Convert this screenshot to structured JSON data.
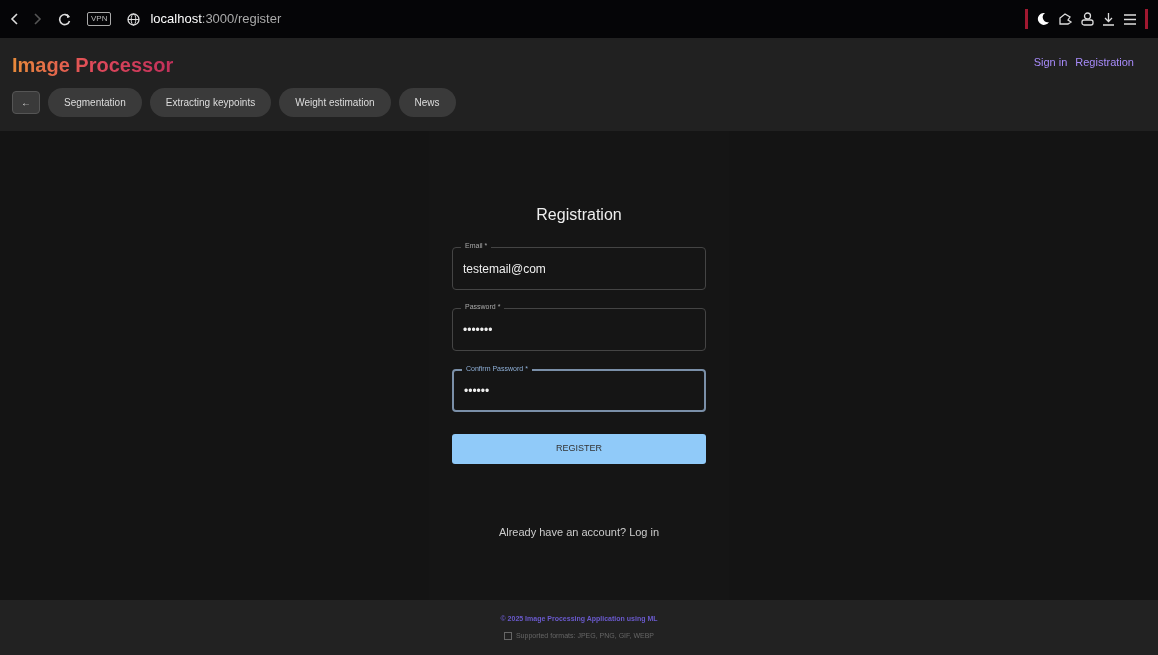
{
  "browser": {
    "vpn_badge": "VPN",
    "url_host": "localhost",
    "url_path": ":3000/register"
  },
  "app": {
    "title": "Image Processor",
    "auth_links": [
      {
        "label": "Sign in"
      },
      {
        "label": "Registration"
      }
    ],
    "back_button": "←",
    "nav": [
      {
        "label": "Segmentation"
      },
      {
        "label": "Extracting keypoints"
      },
      {
        "label": "Weight estimation"
      },
      {
        "label": "News"
      }
    ]
  },
  "form": {
    "title": "Registration",
    "fields": [
      {
        "label": "Email",
        "required": "*",
        "value": "testemail@com",
        "focused": false
      },
      {
        "label": "Password",
        "required": "*",
        "value": "•••••••",
        "focused": false
      },
      {
        "label": "Confirm Password",
        "required": "*",
        "value": "••••••",
        "focused": true
      }
    ],
    "submit": "REGISTER",
    "login_prompt": "Already have an account? Log in"
  },
  "footer": {
    "copyright": "© 2025 Image Processing Application using ML",
    "formats": "Supported formats: JPEG, PNG, GIF, WEBP"
  }
}
